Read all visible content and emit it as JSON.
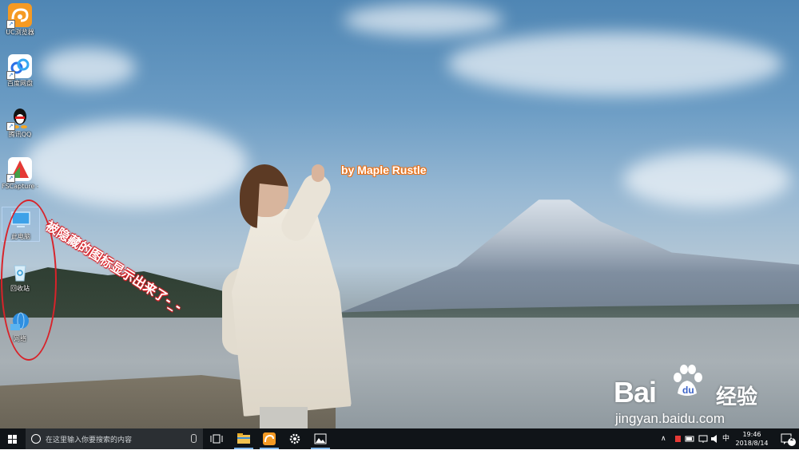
{
  "desktop": {
    "icons": [
      {
        "label": "UC浏览器"
      },
      {
        "label": "百度网盘"
      },
      {
        "label": "腾讯QQ"
      },
      {
        "label": "FSCapture - 快捷方式"
      },
      {
        "label": "此电脑"
      },
      {
        "label": "回收站"
      },
      {
        "label": "网络"
      }
    ],
    "annotation_text": "被隐藏的图标显示出来了-_-",
    "byline": "by Maple Rustle",
    "watermark": {
      "main": "Bai",
      "suffix": "经验",
      "url": "jingyan.baidu.com"
    }
  },
  "taskbar": {
    "search_placeholder": "在这里输入你要搜索的内容",
    "apps": [
      "task-view",
      "file-explorer",
      "uc-browser",
      "settings",
      "photos"
    ],
    "tray": {
      "ime": "中",
      "time": "19:46",
      "date": "2018/8/14",
      "notification_count": "2"
    }
  },
  "colors": {
    "annotation_red": "#d8232a",
    "byline_orange": "#e8741e",
    "taskbar": "#101418"
  }
}
